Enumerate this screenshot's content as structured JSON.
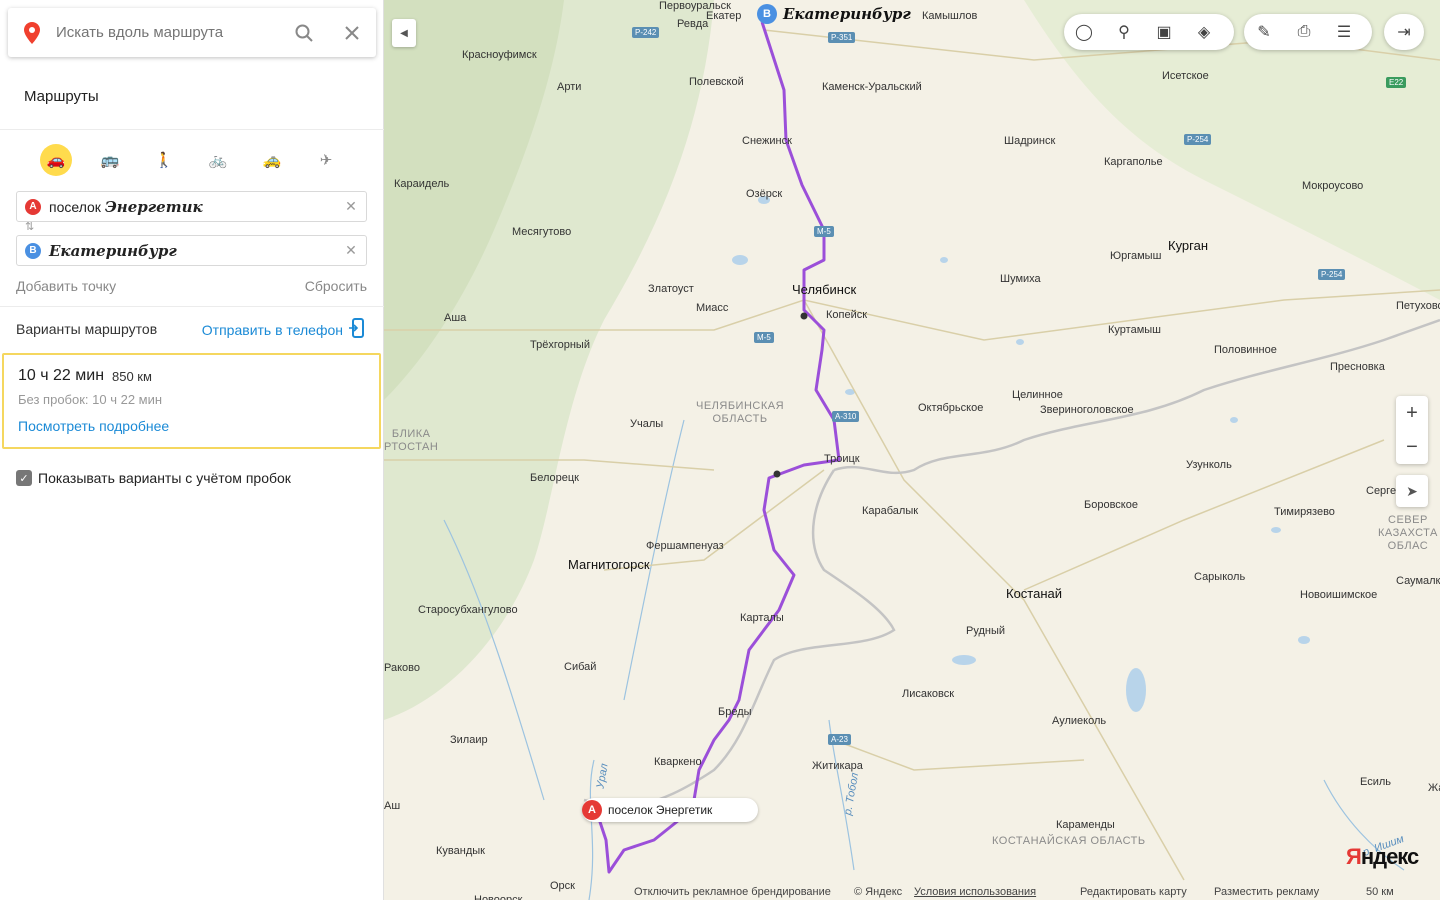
{
  "search": {
    "placeholder": "Искать вдоль маршрута"
  },
  "panel": {
    "routes_title": "Маршруты",
    "modes": [
      {
        "name": "car",
        "glyph": "🚗",
        "active": true
      },
      {
        "name": "bus",
        "glyph": "🚌",
        "active": false
      },
      {
        "name": "walk",
        "glyph": "🚶",
        "active": false
      },
      {
        "name": "bike",
        "glyph": "🚲",
        "active": false
      },
      {
        "name": "taxi",
        "glyph": "🚕",
        "active": false
      },
      {
        "name": "plane",
        "glyph": "✈",
        "active": false
      }
    ],
    "point_a": {
      "badge": "A",
      "prefix": "поселок",
      "value": "Энергетик"
    },
    "point_b": {
      "badge": "B",
      "value": "Екатеринбург"
    },
    "add_point": "Добавить точку",
    "reset": "Сбросить",
    "variants": "Варианты маршрутов",
    "send_to_phone": "Отправить в телефон",
    "route": {
      "time": "10 ч 22 мин",
      "distance": "850 км",
      "no_traffic": "Без пробок: 10 ч 22 мин",
      "details": "Посмотреть подробнее"
    },
    "traffic_checkbox": "Показывать варианты с учётом пробок"
  },
  "map": {
    "pin_b_label": "Екатеринбург",
    "pin_a_label": "поселок Энергетик",
    "route_color": "#9b4fd9",
    "cities": [
      {
        "name": "Первоуральск"
      },
      {
        "name": "Ревда"
      },
      {
        "name": "Екатер"
      },
      {
        "name": "Камышлов"
      },
      {
        "name": "Красноуфимск"
      },
      {
        "name": "Арти"
      },
      {
        "name": "Полевской"
      },
      {
        "name": "Каменск-Уральский"
      },
      {
        "name": "Исетское"
      },
      {
        "name": "Снежинск"
      },
      {
        "name": "Шадринск"
      },
      {
        "name": "Каргаполье"
      },
      {
        "name": "Караидель"
      },
      {
        "name": "Озёрск"
      },
      {
        "name": "Мокроусово"
      },
      {
        "name": "Месягутово"
      },
      {
        "name": "Курган"
      },
      {
        "name": "Юргамыш"
      },
      {
        "name": "Шумиха"
      },
      {
        "name": "Златоуст"
      },
      {
        "name": "Челябинск"
      },
      {
        "name": "Миасс"
      },
      {
        "name": "Копейск"
      },
      {
        "name": "Аша"
      },
      {
        "name": "Петухово"
      },
      {
        "name": "Куртамыш"
      },
      {
        "name": "Трёхгорный"
      },
      {
        "name": "Половинное"
      },
      {
        "name": "Пресновка"
      },
      {
        "name": "Целинное"
      },
      {
        "name": "Октябрьское"
      },
      {
        "name": "Звериноголовское"
      },
      {
        "name": "Учалы"
      },
      {
        "name": "Троицк"
      },
      {
        "name": "Узунколь"
      },
      {
        "name": "Белорецк"
      },
      {
        "name": "Сергеевка"
      },
      {
        "name": "Карабалык"
      },
      {
        "name": "Боровское"
      },
      {
        "name": "Тимирязево"
      },
      {
        "name": "Фершампенуаз"
      },
      {
        "name": "Магнитогорск"
      },
      {
        "name": "Сарыколь"
      },
      {
        "name": "Костанай"
      },
      {
        "name": "Саумалколь"
      },
      {
        "name": "Новоишимское"
      },
      {
        "name": "Старосубхангулово"
      },
      {
        "name": "Карталы"
      },
      {
        "name": "Рудный"
      },
      {
        "name": "Раково"
      },
      {
        "name": "Сибай"
      },
      {
        "name": "Лисаковск"
      },
      {
        "name": "Бреды"
      },
      {
        "name": "Аулиеколь"
      },
      {
        "name": "Зилаир"
      },
      {
        "name": "Кваркено"
      },
      {
        "name": "Житикара"
      },
      {
        "name": "Есиль"
      },
      {
        "name": "Жаксы"
      },
      {
        "name": "Кувандык"
      },
      {
        "name": "Караменды"
      },
      {
        "name": "Орск"
      },
      {
        "name": "Новоорск"
      },
      {
        "name": "Аш"
      }
    ],
    "regions": [
      {
        "text": "ЧЕЛЯБИНСКАЯ\nОБЛАСТЬ"
      },
      {
        "text": "БЛИКА\nРТОСТАН"
      },
      {
        "text": "СЕВЕР\nКАЗАХСТА\nОБЛАС"
      },
      {
        "text": "КОСТАНАЙСКАЯ ОБЛАСТЬ"
      }
    ],
    "rivers": [
      {
        "name": "Урал"
      },
      {
        "name": "р. Тобол"
      },
      {
        "name": "р. Ишим"
      }
    ],
    "road_signs": [
      {
        "text": "Р-242"
      },
      {
        "text": "Р-351"
      },
      {
        "text": "М-5"
      },
      {
        "text": "М-5"
      },
      {
        "text": "Р-254"
      },
      {
        "text": "Р-254"
      },
      {
        "text": "А-310"
      },
      {
        "text": "А-23"
      },
      {
        "text": "E22"
      }
    ],
    "toolbar_icons": [
      "traffic-icon",
      "panorama-icon",
      "transport-icon",
      "layers-icon"
    ],
    "toolbar2_icons": [
      "ruler-icon",
      "print-icon",
      "menu-icon"
    ],
    "zoom_in": "+",
    "zoom_out": "−",
    "footer": {
      "disable_branding": "Отключить рекламное брендирование",
      "copyright": "© Яндекс",
      "terms": "Условия использования",
      "edit_map": "Редактировать карту",
      "place_ad": "Разместить рекламу",
      "scale": "50 км"
    },
    "brand": {
      "first": "Я",
      "rest": "ндекс"
    }
  }
}
